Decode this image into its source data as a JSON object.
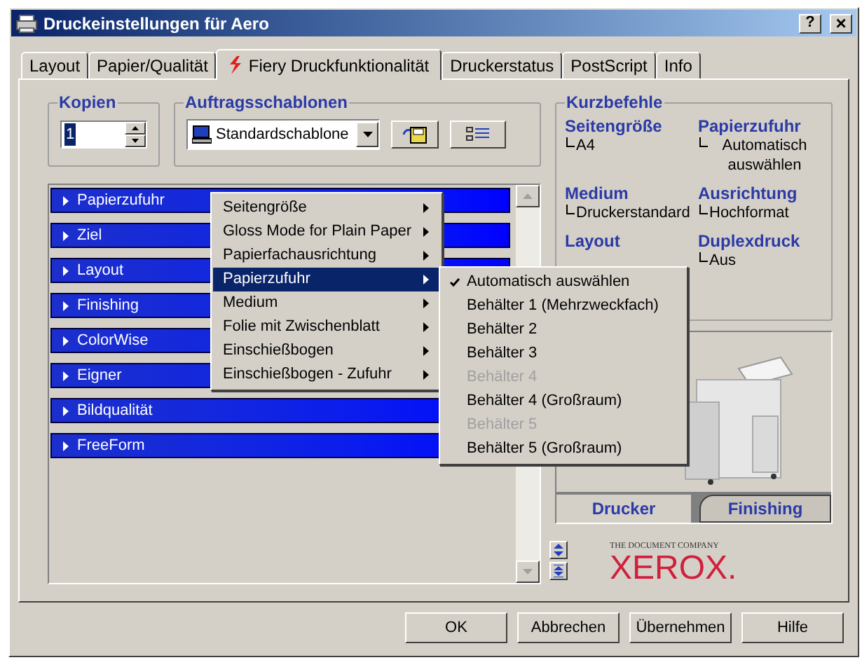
{
  "window": {
    "title": "Druckeinstellungen für Aero",
    "help_button": "?",
    "close_button": "×"
  },
  "tabs": [
    {
      "label": "Layout",
      "selected": false,
      "icon": false
    },
    {
      "label": "Papier/Qualität",
      "selected": false,
      "icon": false
    },
    {
      "label": "Fiery Druckfunktionalität",
      "selected": true,
      "icon": true
    },
    {
      "label": "Druckerstatus",
      "selected": false,
      "icon": false
    },
    {
      "label": "PostScript",
      "selected": false,
      "icon": false
    },
    {
      "label": "Info",
      "selected": false,
      "icon": false
    }
  ],
  "copies": {
    "label": "Kopien",
    "value": "1"
  },
  "templates": {
    "label": "Auftragsschablonen",
    "value": "Standardschablone"
  },
  "feature_list": [
    {
      "label": "Papierzufuhr"
    },
    {
      "label": "Ziel"
    },
    {
      "label": "Layout"
    },
    {
      "label": "Finishing"
    },
    {
      "label": "ColorWise"
    },
    {
      "label": "Eigner"
    },
    {
      "label": "Bildqualität"
    },
    {
      "label": "FreeForm"
    }
  ],
  "context_menu": [
    {
      "label": "Seitengröße",
      "selected": false
    },
    {
      "label": "Gloss Mode for Plain Paper",
      "selected": false
    },
    {
      "label": "Papierfachausrichtung",
      "selected": false
    },
    {
      "label": "Papierzufuhr",
      "selected": true
    },
    {
      "label": "Medium",
      "selected": false
    },
    {
      "label": "Folie mit Zwischenblatt",
      "selected": false
    },
    {
      "label": "Einschießbogen",
      "selected": false
    },
    {
      "label": "Einschießbogen - Zufuhr",
      "selected": false
    }
  ],
  "submenu": [
    {
      "label": "Automatisch auswählen",
      "checked": true,
      "disabled": false
    },
    {
      "label": "Behälter 1 (Mehrzweckfach)",
      "checked": false,
      "disabled": false
    },
    {
      "label": "Behälter 2",
      "checked": false,
      "disabled": false
    },
    {
      "label": "Behälter 3",
      "checked": false,
      "disabled": false
    },
    {
      "label": "Behälter 4",
      "checked": false,
      "disabled": true
    },
    {
      "label": "Behälter 4 (Großraum)",
      "checked": false,
      "disabled": false
    },
    {
      "label": "Behälter 5",
      "checked": false,
      "disabled": true
    },
    {
      "label": "Behälter 5 (Großraum)",
      "checked": false,
      "disabled": false
    }
  ],
  "shortcuts": {
    "title": "Kurzbefehle",
    "items": [
      {
        "heading": "Seitengröße",
        "value": "A4"
      },
      {
        "heading": "Papierzufuhr",
        "value": "Automatisch auswählen"
      },
      {
        "heading": "Medium",
        "value": "Druckerstandard"
      },
      {
        "heading": "Ausrichtung",
        "value": "Hochformat"
      },
      {
        "heading": "Layout"
      },
      {
        "heading": "Duplexdruck",
        "value": "Aus"
      }
    ]
  },
  "printer_view": {
    "kind": "picture",
    "tabs": [
      {
        "label": "Drucker",
        "selected": true
      },
      {
        "label": "Finishing",
        "selected": false
      }
    ]
  },
  "logo": {
    "tagline": "THE DOCUMENT COMPANY",
    "name": "XEROX."
  },
  "buttons": [
    {
      "label": "OK"
    },
    {
      "label": "Abbrechen"
    },
    {
      "label": "Übernehmen"
    },
    {
      "label": "Hilfe"
    }
  ]
}
